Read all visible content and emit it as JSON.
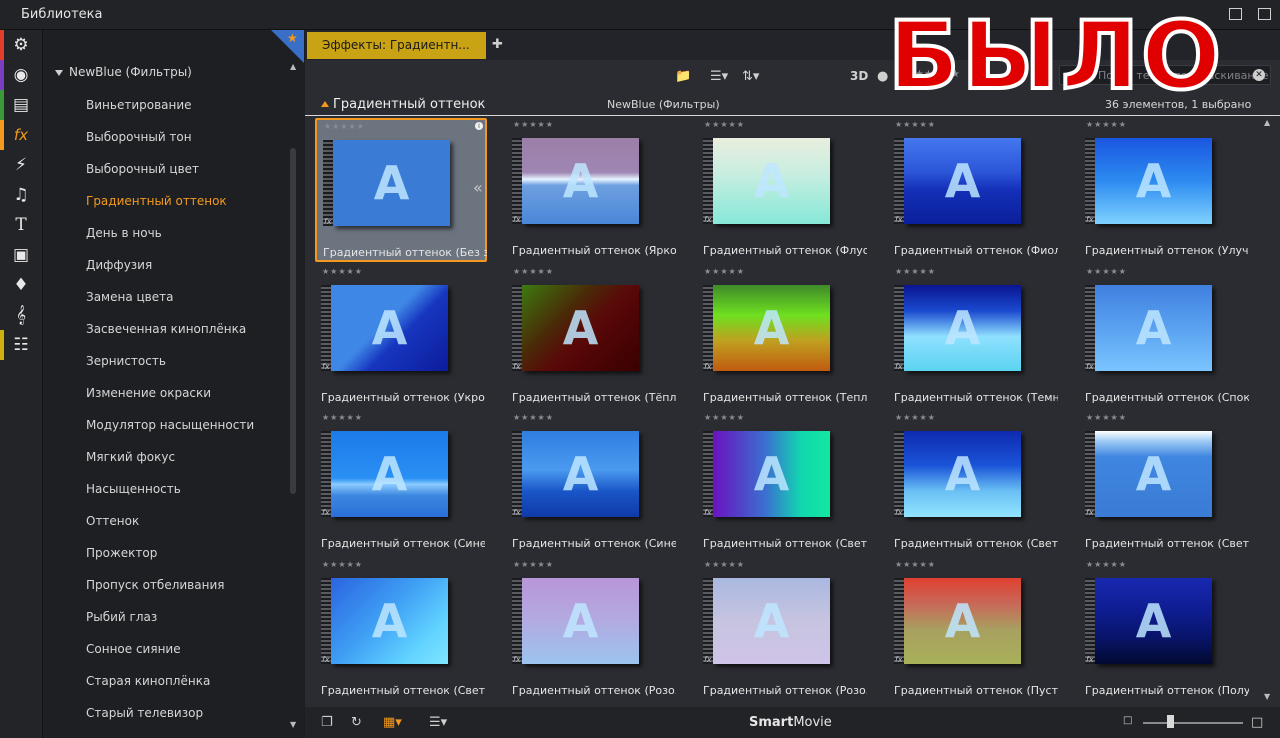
{
  "window": {
    "title": "Библиотека"
  },
  "tree": {
    "root": "NewBlue (Фильтры)",
    "items": [
      "Виньетирование",
      "Выборочный тон",
      "Выборочный цвет",
      "Градиентный оттенок",
      "День в ночь",
      "Диффузия",
      "Замена цвета",
      "Засвеченная киноплёнка",
      "Зернистость",
      "Изменение окраски",
      "Модулятор насыщенности",
      "Мягкий фокус",
      "Насыщенность",
      "Оттенок",
      "Прожектор",
      "Пропуск отбеливания",
      "Рыбий глаз",
      "Сонное сияние",
      "Старая киноплёнка",
      "Старый телевизор"
    ],
    "selected_index": 3
  },
  "tab": {
    "label": "Эффекты: Градиентн..."
  },
  "toolbar": {
    "mode3d": "3D",
    "search_placeholder": "Поиск темы, перетаскивание"
  },
  "info": {
    "folder": "Градиентный оттенок",
    "category": "NewBlue (Фильтры)",
    "count": "36 элементов, 1 выбрано"
  },
  "accent_color": "#f39a1e",
  "tab_color": "#c9a314",
  "rating_stars": "★★★★★",
  "grid_items": [
    {
      "label": "Градиентный оттенок (Без з...",
      "selected": true,
      "bg": "linear-gradient(#3a7bd5,#3a7bd5)"
    },
    {
      "label": "Градиентный оттенок (Ярко...",
      "selected": false,
      "bg": "linear-gradient(to bottom,#9c7fa8 0%,#9f86b3 40%,#e6f4ff 48%,#6ea0e0 55%,#4a86d8 100%)"
    },
    {
      "label": "Градиентный оттенок (Флуо...",
      "selected": false,
      "bg": "linear-gradient(to bottom,#e9eede 0%,#c9eee0 40%,#86e8d8 100%)"
    },
    {
      "label": "Градиентный оттенок (Фиол...",
      "selected": false,
      "bg": "linear-gradient(to bottom,#4477ee 0%,#2b55d8 40%,#1430b8 60%,#0a1f9a 100%)"
    },
    {
      "label": "Градиентный оттенок (Улуч...",
      "selected": false,
      "bg": "linear-gradient(to bottom,#1a56e0 0%,#2d8bf0 50%,#7fd2ff 100%)"
    },
    {
      "label": "Градиентный оттенок (Укро...",
      "selected": false,
      "bg": "linear-gradient(135deg,#3f87e6 0%,#3f87e6 45%,#1736c0 60%,#0c1c9a 100%)"
    },
    {
      "label": "Градиентный оттенок (Тёпл...",
      "selected": false,
      "bg": "linear-gradient(135deg,#3d7a10 0%,#4a2a08 35%,#5a0808 55%,#3a0000 100%)"
    },
    {
      "label": "Градиентный оттенок (Тепл...",
      "selected": false,
      "bg": "linear-gradient(to bottom,#3f8a2a 0%,#6ee020 35%,#c0a020 65%,#c05a10 100%)"
    },
    {
      "label": "Градиентный оттенок (Темн...",
      "selected": false,
      "bg": "linear-gradient(to bottom,#0a1490 0%,#1a4ad0 30%,#8fe0ff 60%,#5ad4f0 100%)"
    },
    {
      "label": "Градиентный оттенок (Спок...",
      "selected": false,
      "bg": "linear-gradient(to bottom,#3f80e0 0%,#5aa2f0 50%,#7ac4ff 100%)"
    },
    {
      "label": "Градиентный оттенок (Сине...",
      "selected": false,
      "bg": "linear-gradient(to bottom,#1b7ae8 0%,#2a90f4 55%,#8ccbff 62%,#3c88e0 75%,#2b6ed8 100%)"
    },
    {
      "label": "Градиентный оттенок (Сине...",
      "selected": false,
      "bg": "linear-gradient(to bottom,#2f7ee0 0%,#4a9af0 45%,#1a56c8 70%,#0f3aa8 100%)"
    },
    {
      "label": "Градиентный оттенок (Свет...",
      "selected": false,
      "bg": "linear-gradient(to right,#6a12c0 0%,#3a70d0 45%,#12d6b0 75%,#12e8a0 100%)"
    },
    {
      "label": "Градиентный оттенок (Свет...",
      "selected": false,
      "bg": "linear-gradient(to bottom,#0e2ab0 0%,#1a54d8 40%,#6ac0f4 70%,#92e4ff 100%)"
    },
    {
      "label": "Градиентный оттенок (Свет ...",
      "selected": false,
      "bg": "linear-gradient(to bottom,#ffffff 0%,#9ccaf4 12%,#3f86e0 30%,#3a7bd5 100%)"
    },
    {
      "label": "Градиентный оттенок (Свет ...",
      "selected": false,
      "bg": "linear-gradient(135deg,#2a64e0 0%,#3fa0f4 45%,#5fd0ff 75%,#7fe6ff 100%)"
    },
    {
      "label": "Градиентный оттенок (Розо...",
      "selected": false,
      "bg": "linear-gradient(to bottom,#b896d8 0%,#b4a8e0 45%,#9cc4ee 100%)"
    },
    {
      "label": "Градиентный оттенок (Розо...",
      "selected": false,
      "bg": "linear-gradient(to bottom,#aab8e0 0%,#c6c4e0 50%,#d0c4e8 100%)"
    },
    {
      "label": "Градиентный оттенок (Пуст...",
      "selected": false,
      "bg": "linear-gradient(to bottom,#e04030 0%,#c86858 30%,#a8a060 60%,#a8b058 100%)"
    },
    {
      "label": "Градиентный оттенок (Полу...",
      "selected": false,
      "bg": "linear-gradient(to bottom,#1828b0 0%,#0e1c90 40%,#081468 70%,#020a30 100%)"
    }
  ],
  "bottom": {
    "brand_bold": "Smart",
    "brand_rest": "Movie"
  },
  "overlay_text": "БЫЛО"
}
